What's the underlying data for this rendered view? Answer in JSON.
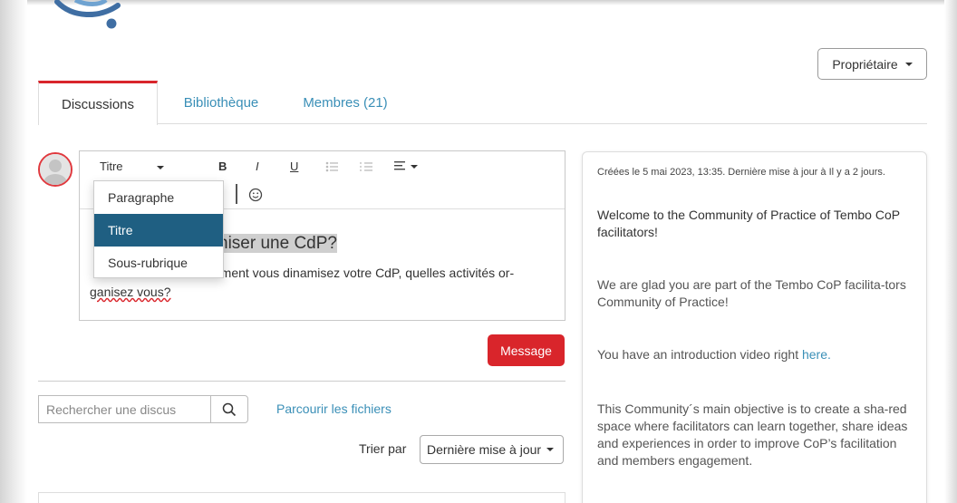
{
  "owner_menu": {
    "label": "Propriétaire"
  },
  "tabs": [
    {
      "label": "Discussions"
    },
    {
      "label": "Bibliothèque"
    },
    {
      "label": "Membres (21)"
    }
  ],
  "editor": {
    "format_select": "Titre",
    "bold": "B",
    "italic": "I",
    "underline": "U",
    "dropdown_options": [
      "Paragraphe",
      "Titre",
      "Sous-rubrique"
    ],
    "heading_visible": "niser une CdP?",
    "body_line1_visible": "mment vous dinamisez votre CdP, quelles activités or-",
    "body_line2": "ganisez vous?"
  },
  "message_button": "Message",
  "search": {
    "placeholder": "Rechercher une discus"
  },
  "browse_files_link": "Parcourir les fichiers",
  "sort": {
    "label": "Trier par",
    "selected": "Dernière mise à jour"
  },
  "sidebar": {
    "meta": "Créées le 5 mai 2023, 13:35. Dernière mise à jour à Il y a 2 jours.",
    "welcome": "Welcome to the Community of Practice of Tembo CoP facilitators!",
    "glad": "We are glad you are part of the Tembo CoP facilita-tors Community of Practice!",
    "video_prefix": "You have an introduction video right ",
    "video_link": "here.",
    "objective": "This Community´s main objective is to create a sha-red space where facilitators can learn together, share ideas and experiences in order to improve CoP’s facilitation and members engagement."
  },
  "colors": {
    "accent_red": "#d9252b",
    "link_blue": "#3a8fb7",
    "selected_blue": "#1f5f82"
  }
}
